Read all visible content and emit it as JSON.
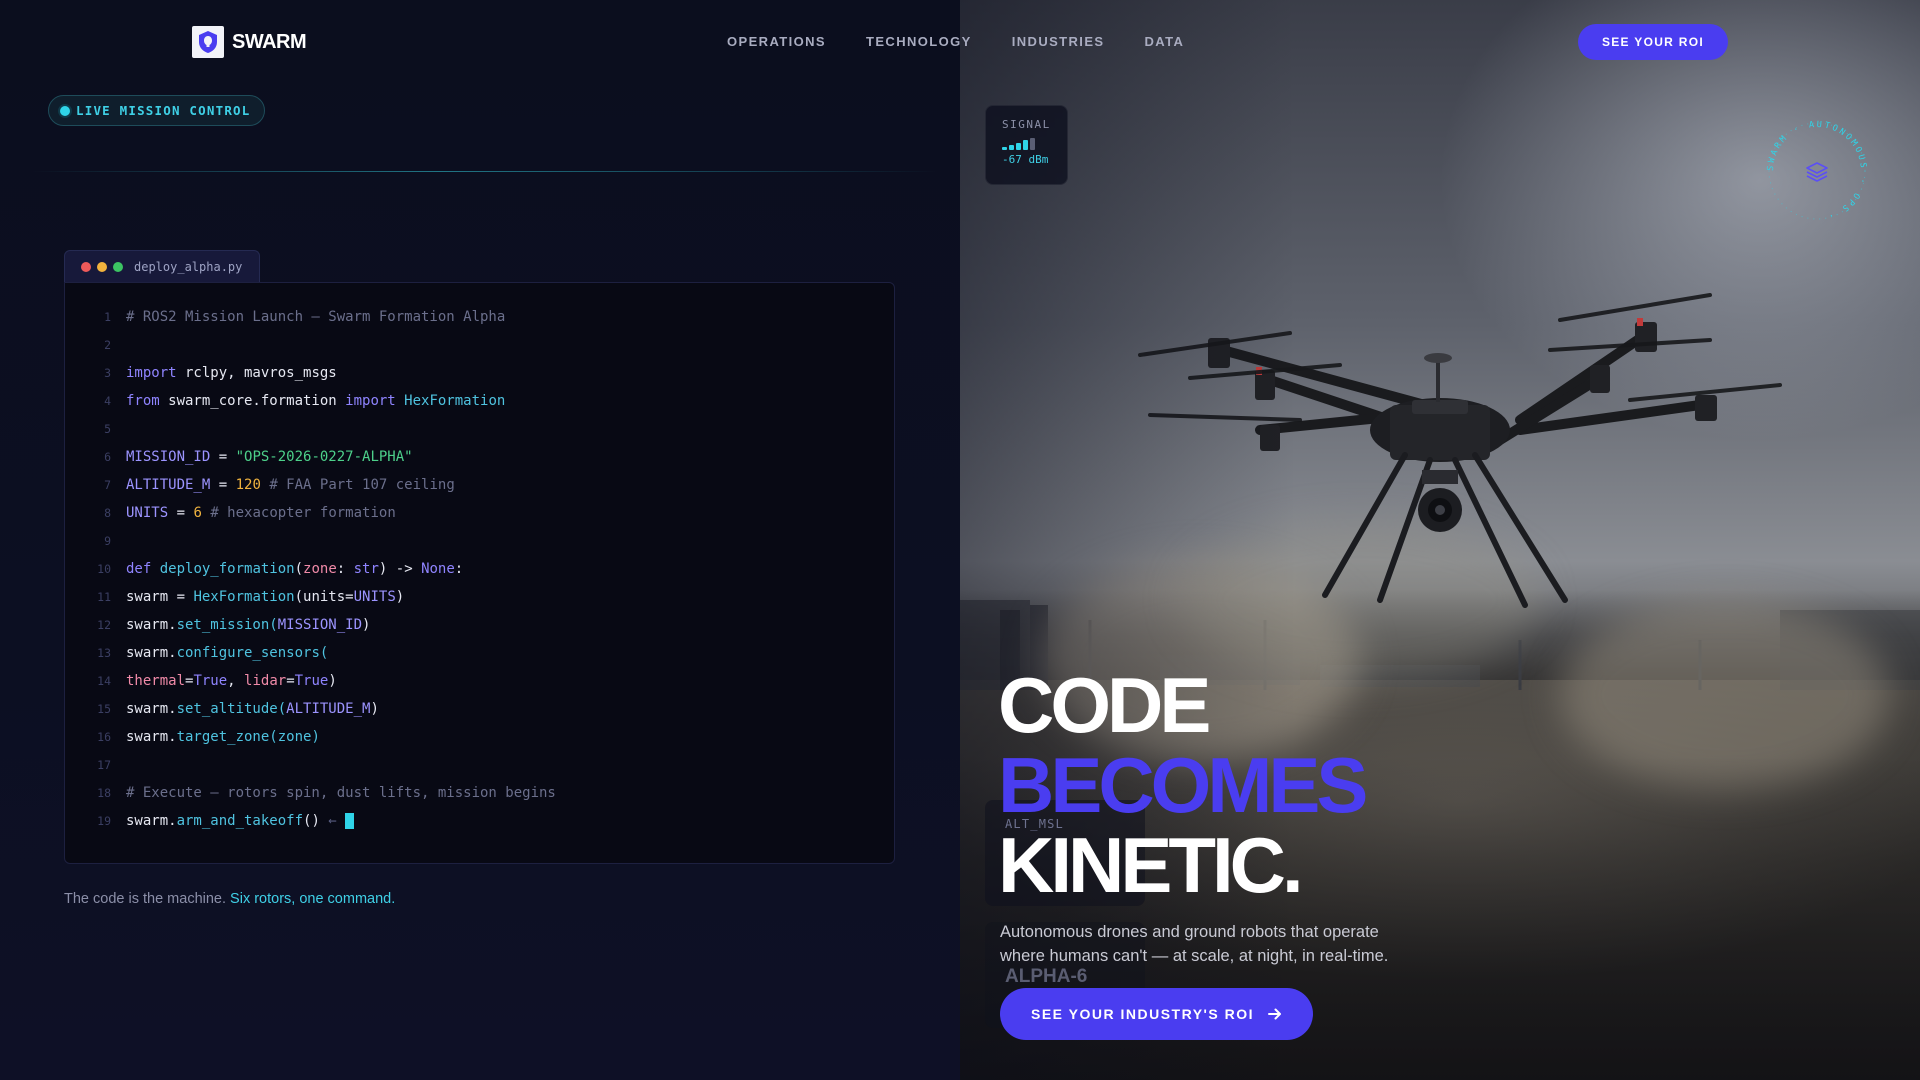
{
  "brand": {
    "name": "SWARM"
  },
  "nav": {
    "items": [
      "OPERATIONS",
      "TECHNOLOGY",
      "INDUSTRIES",
      "DATA"
    ],
    "cta_label": "SEE YOUR ROI"
  },
  "status": {
    "live_label": "LIVE MISSION CONTROL"
  },
  "editor": {
    "filename": "deploy_alpha.py",
    "line_numbers": [
      "1",
      "2",
      "3",
      "4",
      "5",
      "6",
      "7",
      "8",
      "9",
      "10",
      "11",
      "12",
      "13",
      "14",
      "15",
      "16",
      "17",
      "18",
      "19"
    ],
    "code": {
      "l1": "# ROS2 Mission Launch — Swarm Formation Alpha",
      "l3_kw": "import",
      "l3_rest": " rclpy, mavros_msgs",
      "l4_kw1": "from",
      "l4_mod": " swarm_core.formation ",
      "l4_kw2": "import",
      "l4_cls": " HexFormation",
      "l6_var": "MISSION_ID",
      "l6_eq": " = ",
      "l6_str": "\"OPS-2026-0227-ALPHA\"",
      "l7_var": "ALTITUDE_M",
      "l7_eq": " = ",
      "l7_num": "120",
      "l7_com": " # FAA Part 107 ceiling",
      "l8_var": "UNITS",
      "l8_eq": " = ",
      "l8_num": "6",
      "l8_com": " # hexacopter formation",
      "l10_def": "def",
      "l10_fn": " deploy_formation",
      "l10_p1": "(",
      "l10_param": "zone",
      "l10_p2": ": ",
      "l10_type": "str",
      "l10_p3": ") -> ",
      "l10_none": "None",
      "l10_p4": ":",
      "l11_a": "swarm = ",
      "l11_cls": "HexFormation",
      "l11_b": "(units=",
      "l11_const": "UNITS",
      "l11_c": ")",
      "l12_a": "swarm.",
      "l12_fn": "set_mission(",
      "l12_const": "MISSION_ID",
      "l12_b": ")",
      "l13_a": "swarm.",
      "l13_fn": "configure_sensors(",
      "l14_p1": "thermal",
      "l14_eq1": "=",
      "l14_v1": "True",
      "l14_sep": ", ",
      "l14_p2": "lidar",
      "l14_eq2": "=",
      "l14_v2": "True",
      "l14_end": ")",
      "l15_a": "swarm.",
      "l15_fn": "set_altitude(",
      "l15_const": "ALTITUDE_M",
      "l15_b": ")",
      "l16_a": "swarm.",
      "l16_fn": "target_zone(zone)",
      "l18": "# Execute — rotors spin, dust lifts, mission begins",
      "l19_a": "swarm.",
      "l19_fn": "arm_and_takeoff",
      "l19_b": "()",
      "l19_arrow": " ←"
    }
  },
  "caption": {
    "text": "The code is the machine. ",
    "highlight": "Six rotors, one command."
  },
  "telemetry": {
    "signal_title": "SIGNAL",
    "signal_value": "-67 dBm",
    "signal_level": 4,
    "signal_max": 5,
    "alt_label": "ALT_MSL",
    "unit_id": "ALPHA-6"
  },
  "badge": {
    "text": "SWARM · AUTONOMOUS · OPS · "
  },
  "hero": {
    "line1": "CODE",
    "line2": "BECOMES",
    "line3": "KINETIC.",
    "subtitle": "Autonomous drones and ground robots that operate where humans can't — at scale, at night, in real-time.",
    "cta_label": "SEE YOUR INDUSTRY'S ROI"
  },
  "colors": {
    "accent": "#4a3df0",
    "cyan": "#2fd4e8",
    "background": "#0b0d1c"
  },
  "icons": [
    "shield-logo-icon",
    "signal-bars-icon",
    "layers-icon",
    "arrow-right-icon"
  ]
}
